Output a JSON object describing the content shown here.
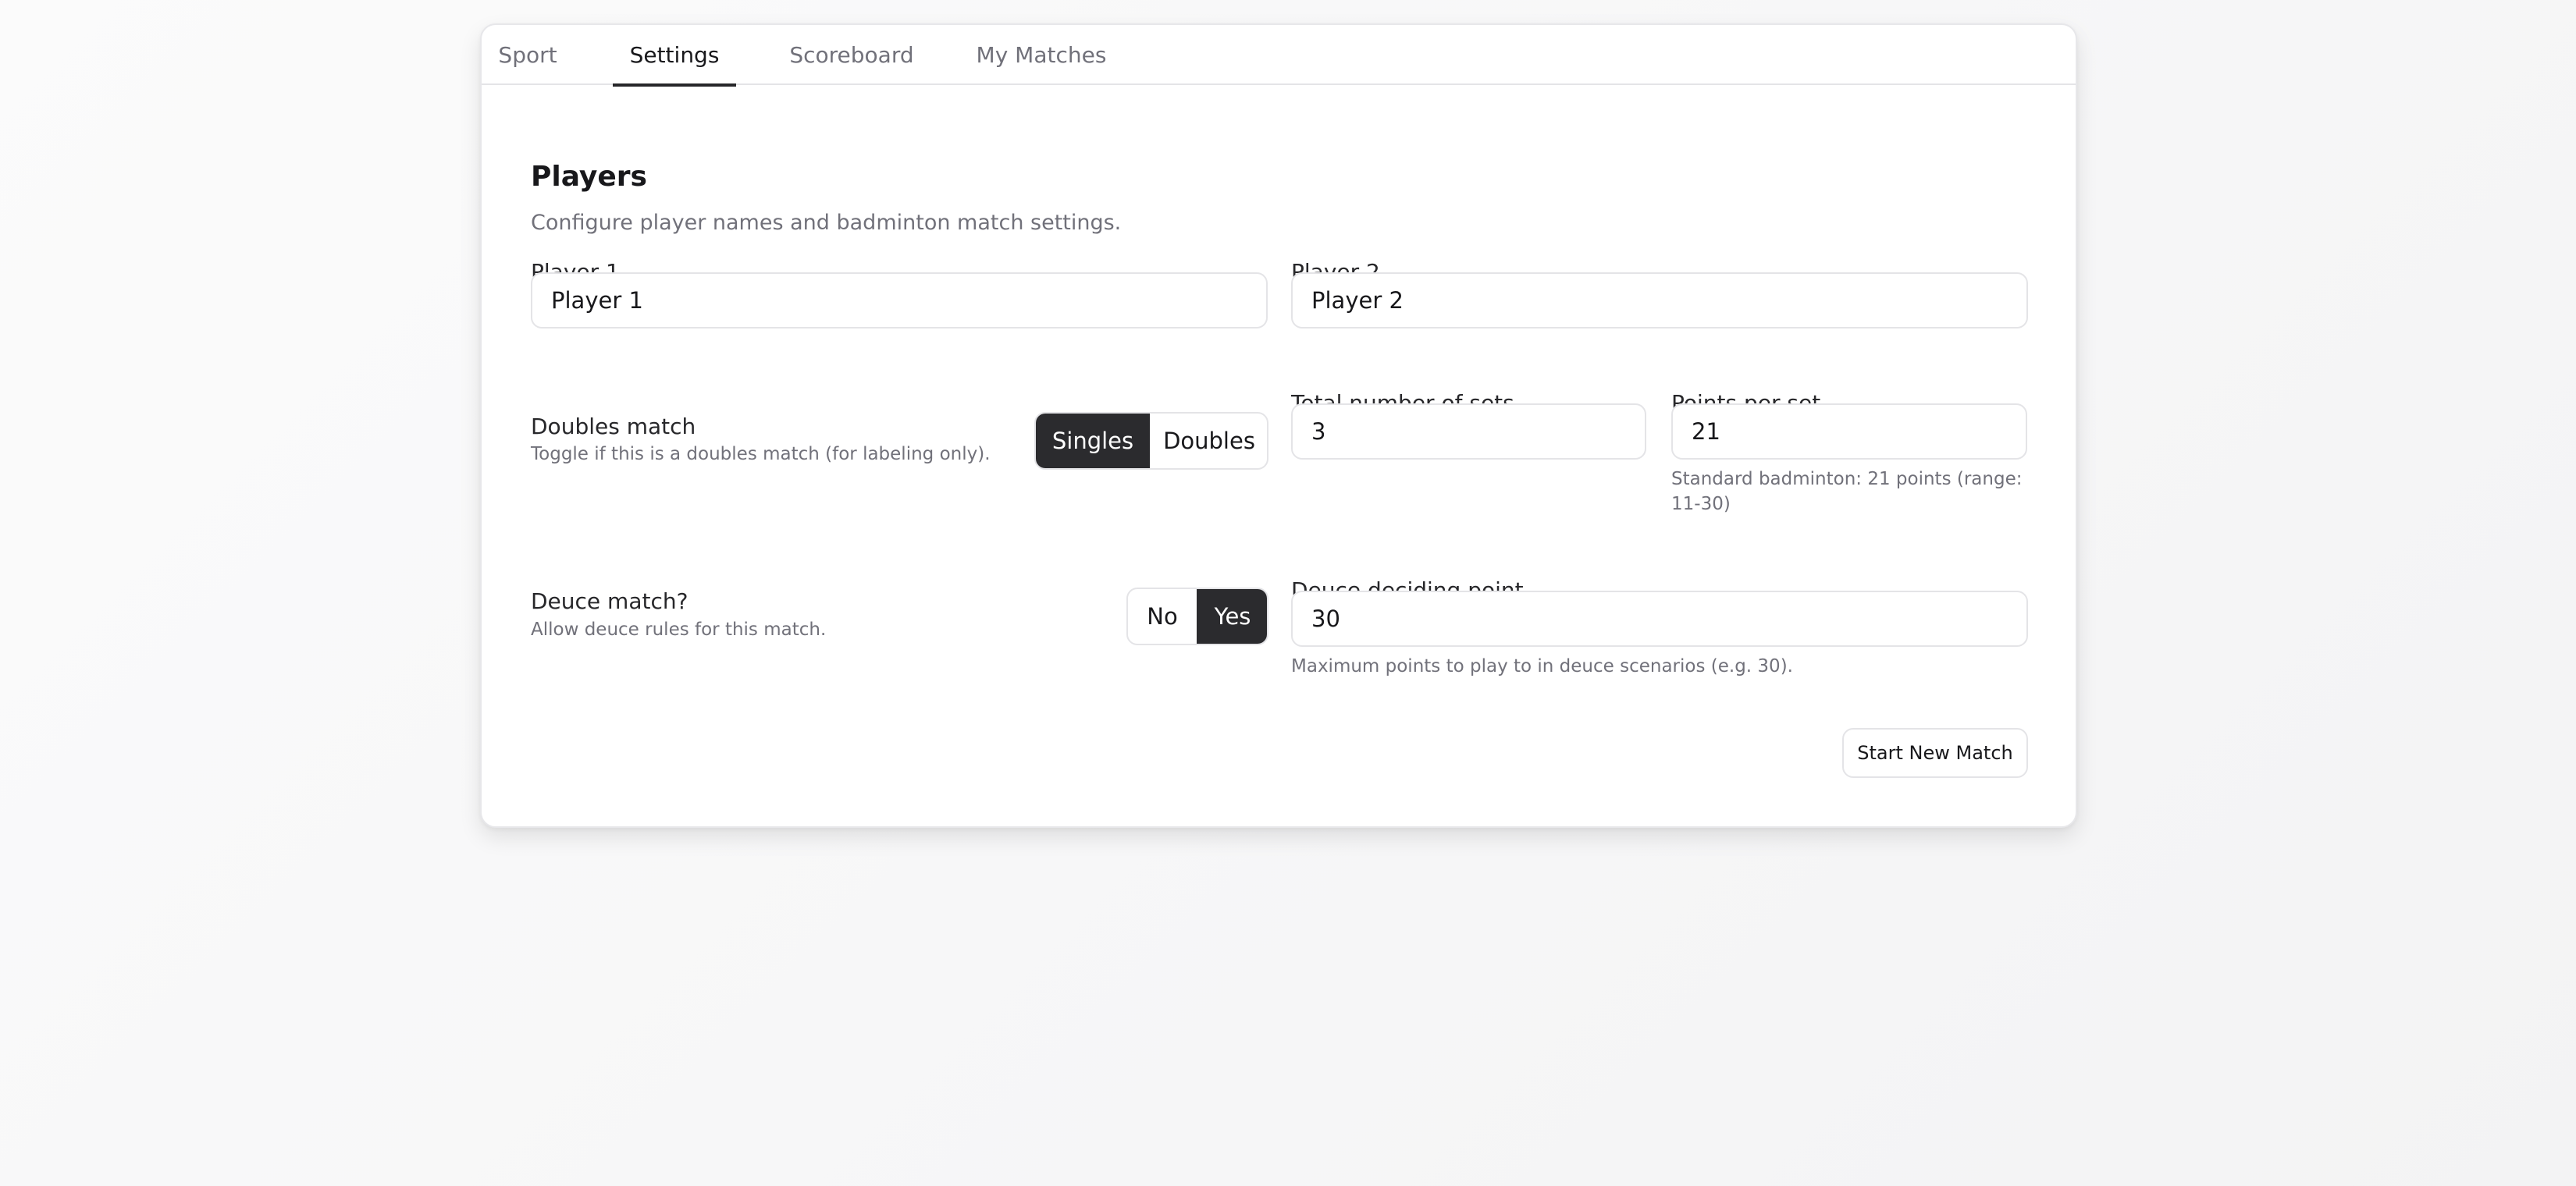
{
  "tabs": [
    {
      "label": "Sport"
    },
    {
      "label": "Settings"
    },
    {
      "label": "Scoreboard"
    },
    {
      "label": "My Matches"
    }
  ],
  "active_tab": "Settings",
  "players_section": {
    "title": "Players",
    "description": "Configure player names and badminton match settings.",
    "player1": {
      "label": "Player 1",
      "value": "Player 1"
    },
    "player2": {
      "label": "Player 2",
      "value": "Player 2"
    }
  },
  "doubles": {
    "label": "Doubles match",
    "description": "Toggle if this is a doubles match (for labeling only).",
    "options": [
      "Singles",
      "Doubles"
    ],
    "selected": "Singles"
  },
  "sets": {
    "label": "Total number of sets",
    "value": "3"
  },
  "points": {
    "label": "Points per set",
    "value": "21",
    "hint": "Standard badminton: 21 points (range: 11-30)"
  },
  "deuce": {
    "label": "Deuce match?",
    "description": "Allow deuce rules for this match.",
    "options": [
      "No",
      "Yes"
    ],
    "selected": "Yes"
  },
  "deuce_point": {
    "label": "Deuce deciding point",
    "value": "30",
    "hint": "Maximum points to play to in deuce scenarios (e.g. 30)."
  },
  "actions": {
    "start_label": "Start New Match"
  },
  "colors": {
    "accent": "#2b2b2e",
    "border": "#e4e4e7",
    "muted_text": "#71717a"
  }
}
